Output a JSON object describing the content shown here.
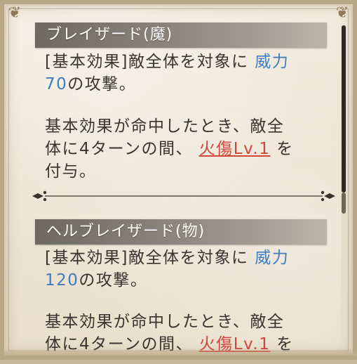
{
  "skills": [
    {
      "name": "ブレイザード(魔)",
      "line1_pre": "[基本効果]敵全体を対象に",
      "power_label": "威力",
      "power_value": "70",
      "line2_post": "の攻撃。",
      "line3": "基本効果が命中したとき、敵全",
      "line4_pre": "体に4ターンの間、",
      "status_link": "火傷Lv.1",
      "line4_post": "を",
      "line5": "付与。"
    },
    {
      "name": "ヘルブレイザード(物)",
      "line1_pre": "[基本効果]敵全体を対象に",
      "power_label": "威力",
      "power_value": "120",
      "line2_post": "の攻撃。",
      "line3": "基本効果が命中したとき、敵全",
      "line4_pre": "体に4ターンの間、",
      "status_link": "火傷Lv.1",
      "line4_post": "を"
    }
  ],
  "colors": {
    "text": "#3a3430",
    "power": "#3f7cc0",
    "status_link": "#d0463c",
    "header_bg": "#6e6862"
  },
  "scrollbar": {
    "position_fraction": 0.0
  }
}
